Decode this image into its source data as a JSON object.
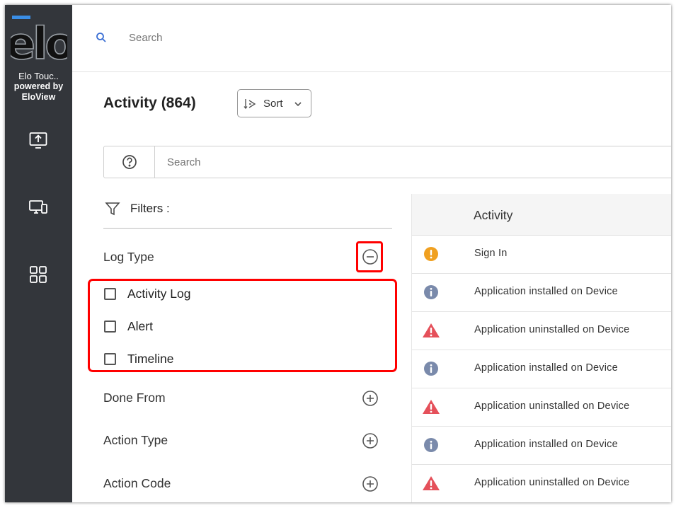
{
  "sidebar": {
    "logo_text": "elo",
    "brand_line1": "Elo Touc..",
    "brand_line2": "powered by",
    "brand_line3": "EloView",
    "nav_icons": [
      "upload-screen-icon",
      "devices-icon",
      "apps-grid-icon"
    ]
  },
  "header": {
    "search_placeholder": "Search"
  },
  "page": {
    "title": "Activity (864)",
    "sort_label": "Sort"
  },
  "search": {
    "placeholder": "Search"
  },
  "filters": {
    "label": "Filters :",
    "log_type": {
      "label": "Log Type",
      "expanded": true,
      "options": [
        "Activity Log",
        "Alert",
        "Timeline"
      ]
    },
    "done_from": {
      "label": "Done From"
    },
    "action_type": {
      "label": "Action Type"
    },
    "action_code": {
      "label": "Action Code"
    }
  },
  "table": {
    "column_activity": "Activity",
    "rows": [
      {
        "icon": "warning-circle-icon",
        "text": "Sign In"
      },
      {
        "icon": "info-icon",
        "text": "Application installed on Device"
      },
      {
        "icon": "alert-triangle-icon",
        "text": "Application uninstalled on Device"
      },
      {
        "icon": "info-icon",
        "text": "Application installed on Device"
      },
      {
        "icon": "alert-triangle-icon",
        "text": "Application uninstalled on Device"
      },
      {
        "icon": "info-icon",
        "text": "Application installed on Device"
      },
      {
        "icon": "alert-triangle-icon",
        "text": "Application uninstalled on Device"
      }
    ]
  },
  "colors": {
    "sidebar_bg": "#33363b",
    "accent_blue": "#3b6fd4",
    "warning_orange": "#f0a020",
    "info_gray_blue": "#7a8aab",
    "alert_red": "#e5505a",
    "highlight_red": "#ff0000"
  }
}
